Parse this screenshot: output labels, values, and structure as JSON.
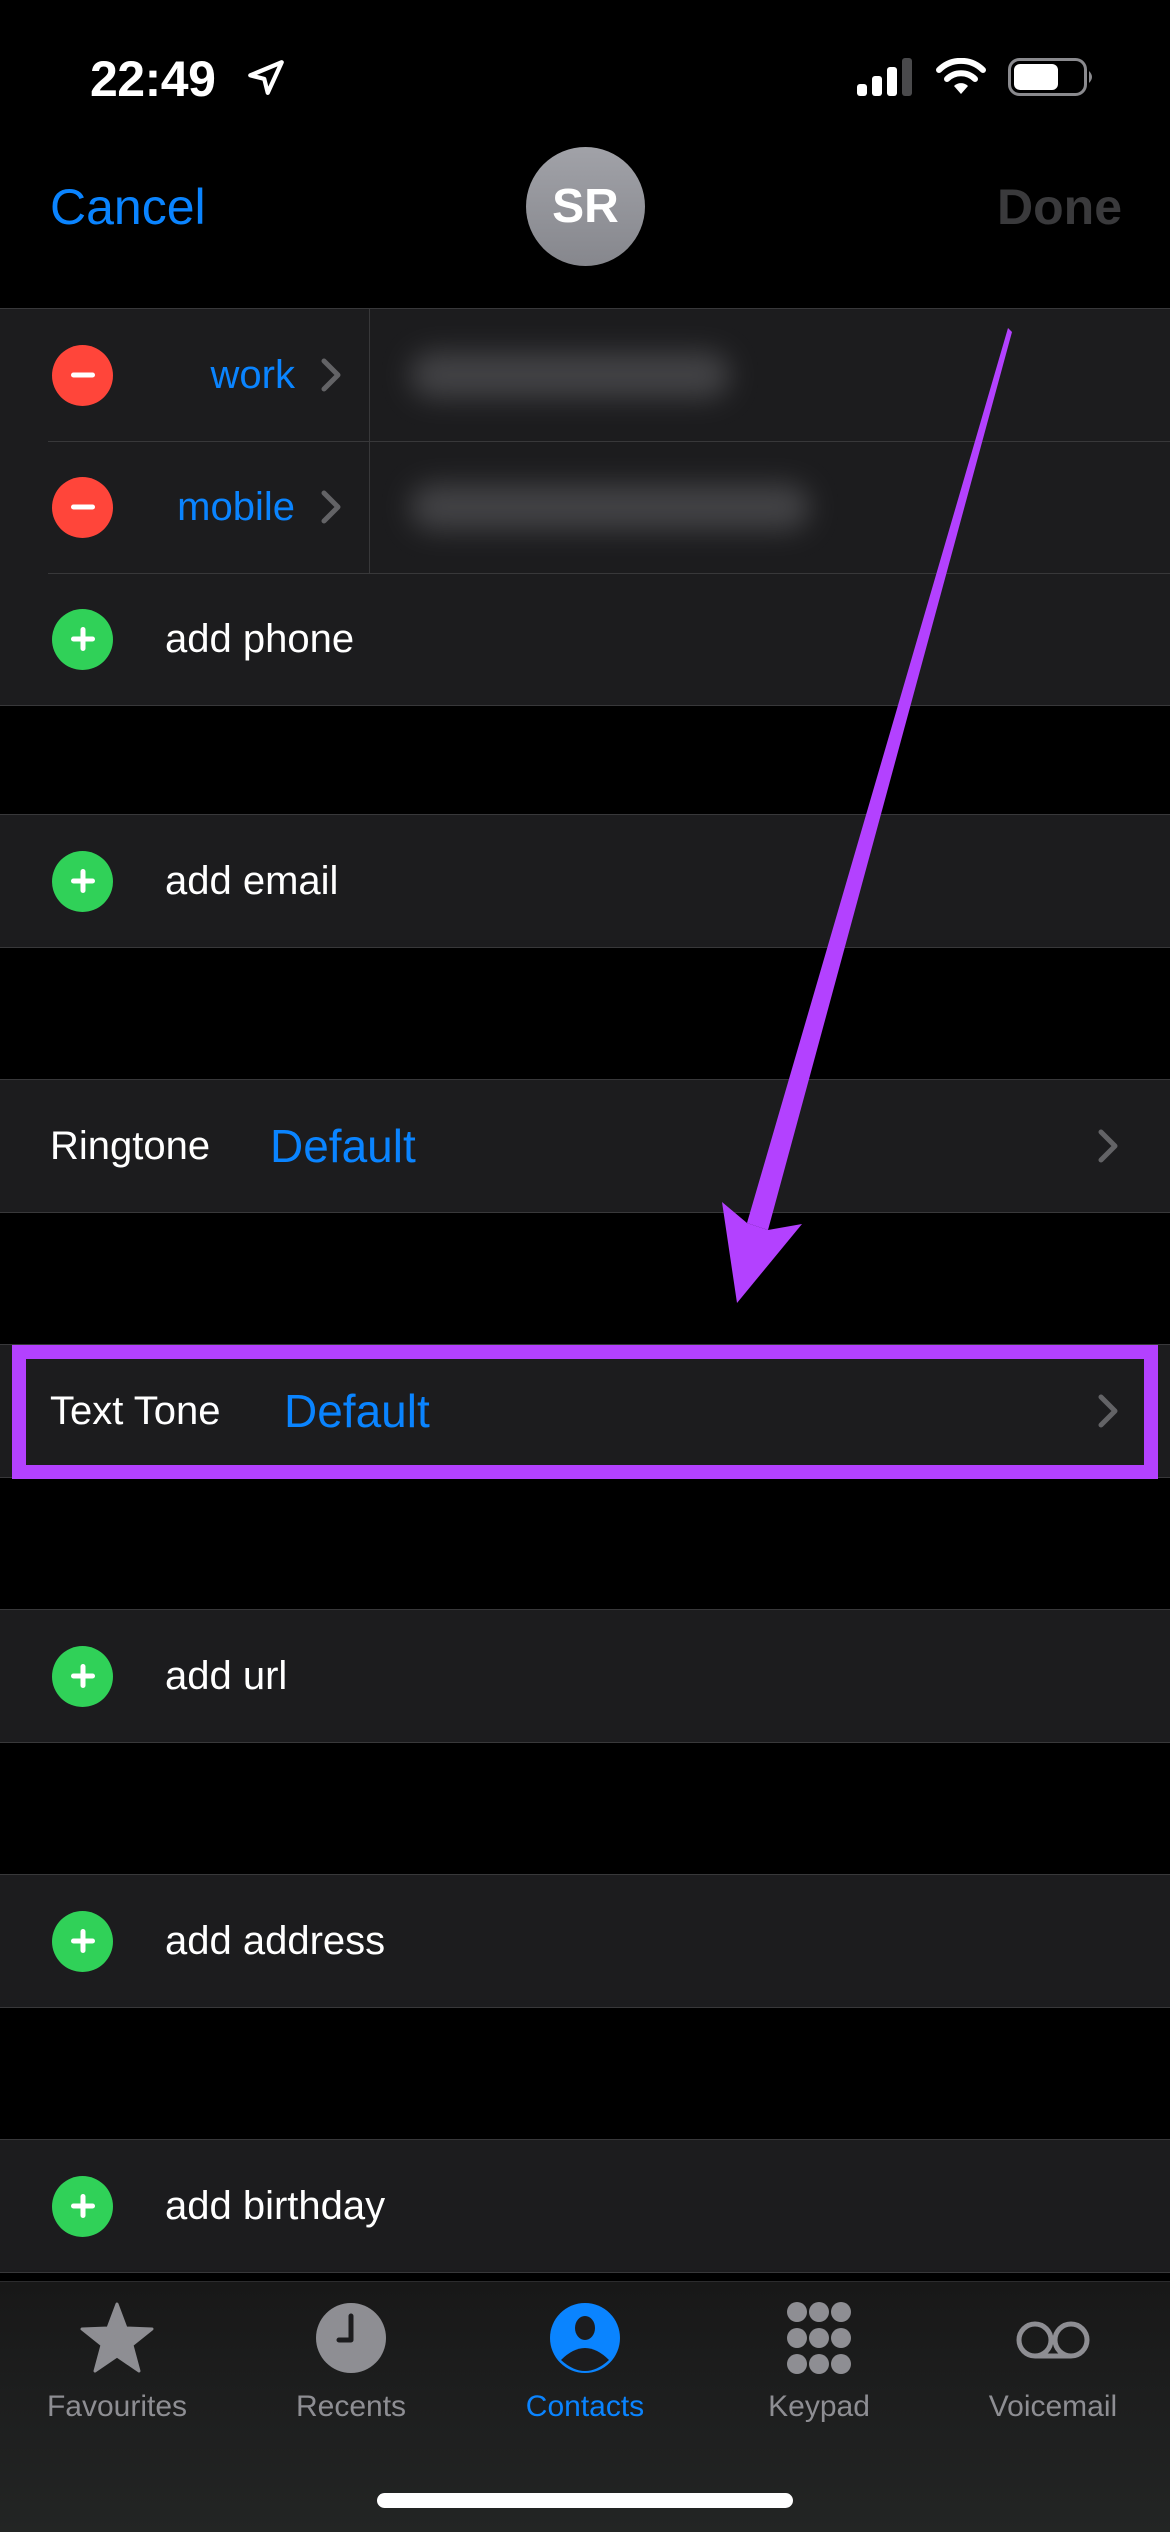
{
  "status_bar": {
    "time": "22:49",
    "location_icon": "location-arrow-icon",
    "signal_bars_lit": 3,
    "signal_bars_total": 4,
    "battery_level": 0.65
  },
  "nav": {
    "cancel_label": "Cancel",
    "done_label": "Done",
    "avatar_initials": "SR"
  },
  "phones": [
    {
      "label": "work"
    },
    {
      "label": "mobile"
    }
  ],
  "add_phone_label": "add phone",
  "add_email_label": "add email",
  "ringtone": {
    "label": "Ringtone",
    "value": "Default"
  },
  "text_tone": {
    "label": "Text Tone",
    "value": "Default"
  },
  "add_url_label": "add url",
  "add_address_label": "add address",
  "add_birthday_label": "add birthday",
  "annotation": {
    "color": "#b341ff",
    "target": "Text Tone"
  },
  "colors": {
    "accent": "#0a84ff",
    "delete": "#ff453a",
    "add": "#30d158",
    "cell_bg": "#1c1c1e"
  },
  "tabbar": {
    "tabs": [
      {
        "label": "Favourites",
        "icon": "star-icon",
        "active": false
      },
      {
        "label": "Recents",
        "icon": "clock-icon",
        "active": false
      },
      {
        "label": "Contacts",
        "icon": "person-circle-icon",
        "active": true
      },
      {
        "label": "Keypad",
        "icon": "keypad-icon",
        "active": false
      },
      {
        "label": "Voicemail",
        "icon": "voicemail-icon",
        "active": false
      }
    ]
  }
}
